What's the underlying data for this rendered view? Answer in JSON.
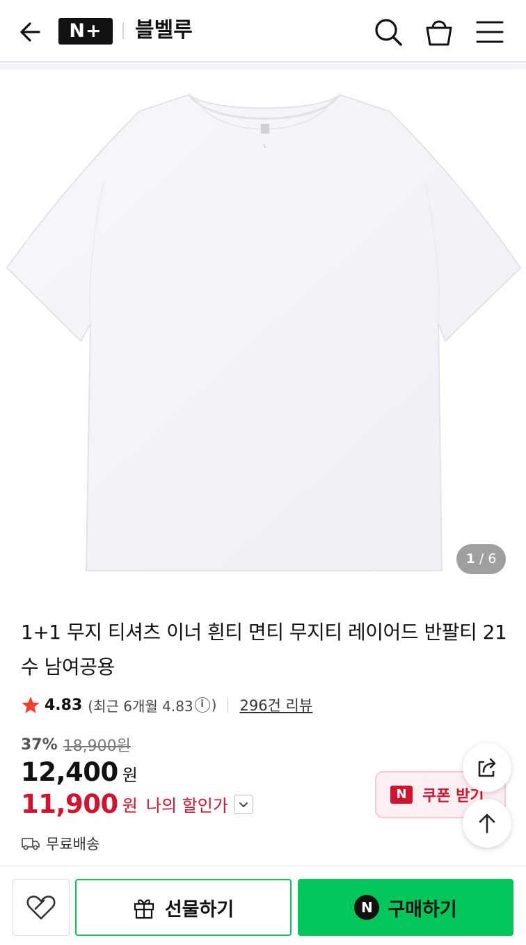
{
  "header": {
    "logo": "N+",
    "store_name": "블벨루"
  },
  "gallery": {
    "current": "1",
    "total": "6"
  },
  "product": {
    "title": "1+1 무지 티셔츠 이너 흰티 면티 무지티 레이어드 반팔티 21수 남여공용",
    "rating": "4.83",
    "recent_rating": "(최근 6개월 4.83",
    "recent_close": ")",
    "info_glyph": "i",
    "review_count": "296건 리뷰",
    "discount_pct": "37%",
    "original_price": "18,900원",
    "price": "12,400",
    "price_unit": "원",
    "my_price": "11,900",
    "my_price_unit": "원",
    "my_price_label": "나의 할인가",
    "shipping": "무료배송"
  },
  "coupon": {
    "badge": "N",
    "label": "쿠폰 받기"
  },
  "bottom_bar": {
    "gift_label": "선물하기",
    "buy_badge": "N",
    "buy_label": "구매하기"
  },
  "colors": {
    "naver_green": "#03c75a",
    "discount_red": "#d5112f",
    "star_red": "#f0412f"
  },
  "icons": [
    "back-arrow-icon",
    "search-icon",
    "shopping-bag-icon",
    "menu-icon",
    "star-icon",
    "info-icon",
    "chevron-down-icon",
    "share-icon",
    "arrow-up-icon",
    "truck-icon",
    "heart-icon",
    "gift-icon"
  ]
}
